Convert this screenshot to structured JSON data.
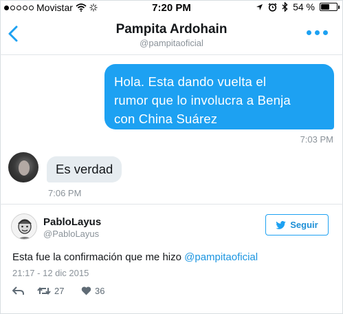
{
  "status_bar": {
    "carrier": "Movistar",
    "time": "7:20 PM",
    "battery": "54 %",
    "battery_level": 0.54,
    "icons": [
      "signal-dots-icon",
      "wifi-icon",
      "activity-spinner-icon",
      "location-arrow-icon",
      "alarm-icon",
      "bluetooth-icon",
      "battery-icon"
    ]
  },
  "nav": {
    "title": "Pampita Ardohain",
    "handle": "@pampitaoficial",
    "icons": [
      "back-chevron-icon",
      "more-dots-icon"
    ]
  },
  "messages": [
    {
      "direction": "outgoing",
      "lines": [
        "Hola. Esta dando vuelta el",
        "rumor que lo involucra a Benja",
        "con China Suárez"
      ],
      "time": "7:03 PM"
    },
    {
      "direction": "incoming",
      "text": "Es verdad",
      "time": "7:06 PM"
    }
  ],
  "tweet": {
    "name": "PabloLayus",
    "handle": "@PabloLayus",
    "follow_label": "Seguir",
    "text": "Esta fue la confirmación que me hizo ",
    "mention": "@pampitaoficial",
    "date": "21:17 - 12 dic 2015",
    "retweets": "27",
    "likes": "36",
    "colors": {
      "accent": "#1da1f2",
      "muted": "#8a9299",
      "bubble_in": "#e6ecf0"
    }
  }
}
